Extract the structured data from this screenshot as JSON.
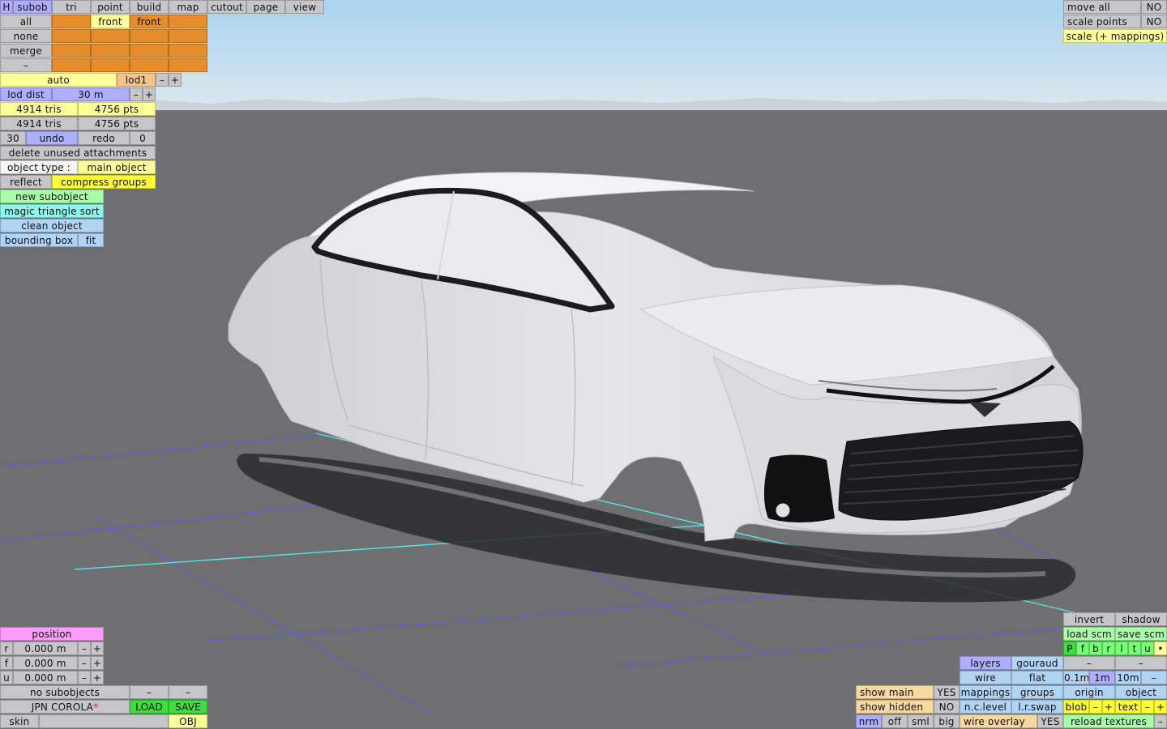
{
  "top_menu": {
    "h": "H",
    "subob": "subob",
    "tri": "tri",
    "point": "point",
    "build": "build",
    "map": "map",
    "cutout": "cutout",
    "page": "page",
    "view": "view"
  },
  "subob_panel": {
    "all": "all",
    "none": "none",
    "merge": "merge",
    "dash": "–",
    "front1": "front",
    "front2": "front"
  },
  "lod": {
    "auto": "auto",
    "lod1": "lod1",
    "minus": "–",
    "plus": "+",
    "lod_dist_label": "lod dist",
    "lod_dist_value": "30 m"
  },
  "stats": {
    "tris1": "4914 tris",
    "pts1": "4756 pts",
    "tris2": "4914 tris",
    "pts2": "4756 pts"
  },
  "history": {
    "undo_count": "30",
    "undo": "undo",
    "redo": "redo",
    "redo_count": "0"
  },
  "tools": {
    "delete_unused": "delete unused attachments",
    "object_type_label": "object type :",
    "object_type_value": "main object",
    "reflect": "reflect",
    "compress_groups": "compress groups",
    "new_subobject": "new subobject",
    "magic_sort": "magic triangle sort",
    "clean_object": "clean object",
    "bounding_box": "bounding box",
    "fit": "fit"
  },
  "top_right": {
    "move_all": "move all",
    "move_all_value": "NO",
    "scale_points": "scale points",
    "scale_points_value": "NO",
    "scale_mappings": "scale (+ mappings)"
  },
  "position": {
    "title": "position",
    "rows": [
      {
        "axis": "r",
        "value": "0.000 m"
      },
      {
        "axis": "f",
        "value": "0.000 m"
      },
      {
        "axis": "u",
        "value": "0.000 m"
      }
    ],
    "minus": "–",
    "plus": "+"
  },
  "bottom_left": {
    "no_subobjects": "no subobjects",
    "dash": "–",
    "model_name": "JPN COROLA",
    "modified_marker": "*",
    "load": "LOAD",
    "save": "SAVE",
    "skin": "skin",
    "obj": "OBJ"
  },
  "bottom_right": {
    "invert": "invert",
    "shadow": "shadow",
    "load_scm": "load scm",
    "save_scm": "save scm",
    "flags": [
      "P",
      "f",
      "b",
      "r",
      "l",
      "t",
      "u",
      "•"
    ],
    "layers": "layers",
    "gouraud": "gouraud",
    "wire": "wire",
    "flat": "flat",
    "mappings": "mappings",
    "groups": "groups",
    "n_c_level": "n.c.level",
    "l_r_swap": "l.r.swap",
    "dash": "–",
    "step_01": "0.1m",
    "step_1": "1m",
    "step_10": "10m",
    "origin": "origin",
    "object": "object",
    "blob": "blob",
    "text": "text",
    "minus": "–",
    "plus": "+",
    "show_main": "show main",
    "show_main_value": "YES",
    "show_hidden": "show hidden",
    "show_hidden_value": "NO",
    "nrm": "nrm",
    "off": "off",
    "sml": "sml",
    "big": "big",
    "wire_overlay": "wire overlay",
    "wire_overlay_value": "YES",
    "reload_textures": "reload textures"
  },
  "colors": {
    "sky_top": "#a9d3ef",
    "ground": "#6f6e70",
    "grid": "#5c5cf0",
    "axis": "#52e6ee",
    "car_body": "#e6e6ea"
  }
}
